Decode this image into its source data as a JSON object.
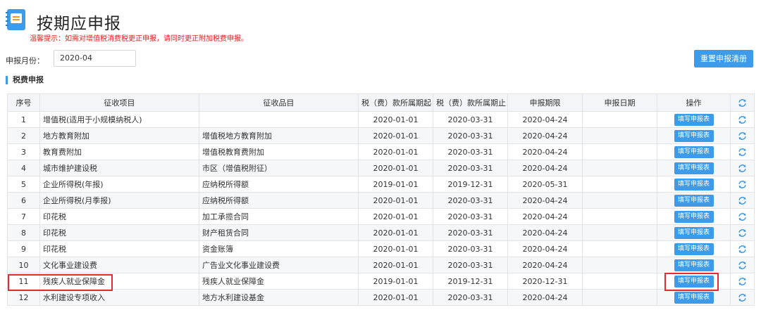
{
  "header": {
    "title": "按期应申报",
    "tip": "温馨提示：如需对增值税消费税更正申报，请同时更正附加税费申报。"
  },
  "filter": {
    "period_label": "申报月份：",
    "period_value": "2020-04"
  },
  "toolbar": {
    "reset_label": "重置申报清册"
  },
  "section": {
    "title": "税费申报"
  },
  "table": {
    "columns": [
      "序号",
      "征收项目",
      "征收品目",
      "税（费）款所属期起",
      "税（费）款所属期止",
      "申报期限",
      "申报日期",
      "操作"
    ],
    "action_label": "填写申报表",
    "rows": [
      {
        "no": "1",
        "item": "增值税(适用于小规模纳税人)",
        "category": "",
        "start": "2020-01-01",
        "end": "2020-03-31",
        "deadline": "2020-04-24",
        "date": ""
      },
      {
        "no": "2",
        "item": "地方教育附加",
        "category": "增值税地方教育附加",
        "start": "2020-01-01",
        "end": "2020-03-31",
        "deadline": "2020-04-24",
        "date": ""
      },
      {
        "no": "3",
        "item": "教育费附加",
        "category": "增值税教育费附加",
        "start": "2020-01-01",
        "end": "2020-03-31",
        "deadline": "2020-04-24",
        "date": ""
      },
      {
        "no": "4",
        "item": "城市维护建设税",
        "category": "市区（增值税附征）",
        "start": "2020-01-01",
        "end": "2020-03-31",
        "deadline": "2020-04-24",
        "date": ""
      },
      {
        "no": "5",
        "item": "企业所得税(年报)",
        "category": "应纳税所得额",
        "start": "2019-01-01",
        "end": "2019-12-31",
        "deadline": "2020-05-31",
        "date": ""
      },
      {
        "no": "6",
        "item": "企业所得税(月季报)",
        "category": "应纳税所得额",
        "start": "2020-01-01",
        "end": "2020-03-31",
        "deadline": "2020-04-24",
        "date": ""
      },
      {
        "no": "7",
        "item": "印花税",
        "category": "加工承揽合同",
        "start": "2020-01-01",
        "end": "2020-03-31",
        "deadline": "2020-04-24",
        "date": ""
      },
      {
        "no": "8",
        "item": "印花税",
        "category": "财产租赁合同",
        "start": "2020-01-01",
        "end": "2020-03-31",
        "deadline": "2020-04-24",
        "date": ""
      },
      {
        "no": "9",
        "item": "印花税",
        "category": "资金账簿",
        "start": "2020-01-01",
        "end": "2020-03-31",
        "deadline": "2020-04-24",
        "date": ""
      },
      {
        "no": "10",
        "item": "文化事业建设费",
        "category": "广告业文化事业建设费",
        "start": "2020-01-01",
        "end": "2020-03-31",
        "deadline": "2020-04-24",
        "date": ""
      },
      {
        "no": "11",
        "item": "残疾人就业保障金",
        "category": "残疾人就业保障金",
        "start": "2019-01-01",
        "end": "2019-12-31",
        "deadline": "2020-12-31",
        "date": ""
      },
      {
        "no": "12",
        "item": "水利建设专项收入",
        "category": "地方水利建设基金",
        "start": "2020-01-01",
        "end": "2020-03-31",
        "deadline": "2020-04-24",
        "date": ""
      }
    ]
  },
  "colors": {
    "accent": "#3d9be9",
    "tip": "#e02020",
    "highlight": "#e02d2d",
    "icon_orange": "#f39a1e"
  },
  "icons": {
    "app": "document-icon",
    "refresh": "refresh-icon"
  }
}
